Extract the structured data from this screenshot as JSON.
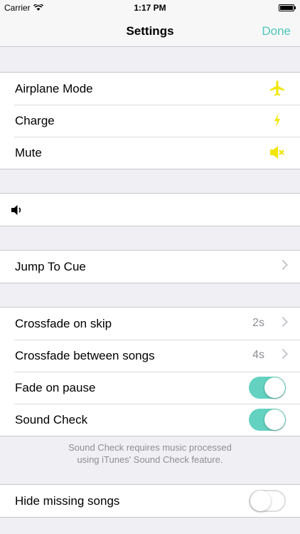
{
  "status": {
    "carrier": "Carrier",
    "time": "1:17 PM"
  },
  "nav": {
    "title": "Settings",
    "done": "Done"
  },
  "modes": {
    "airplane": "Airplane Mode",
    "charge": "Charge",
    "mute": "Mute"
  },
  "volume": {
    "icon": "speaker-icon"
  },
  "jump": {
    "label": "Jump To Cue"
  },
  "playback": {
    "crossfade_skip": "Crossfade on skip",
    "crossfade_skip_value": "2s",
    "crossfade_songs": "Crossfade between songs",
    "crossfade_songs_value": "4s",
    "fade_pause": "Fade on pause",
    "fade_pause_on": true,
    "sound_check": "Sound Check",
    "sound_check_on": true,
    "footer_line1": "Sound Check requires music processed",
    "footer_line2": "using iTunes' Sound Check feature."
  },
  "library": {
    "hide_missing": "Hide missing songs",
    "hide_missing_on": false
  },
  "colors": {
    "accent": "#4fc7bb",
    "toggle_on": "#64d2c1",
    "icon_yellow": "#f2e600"
  }
}
